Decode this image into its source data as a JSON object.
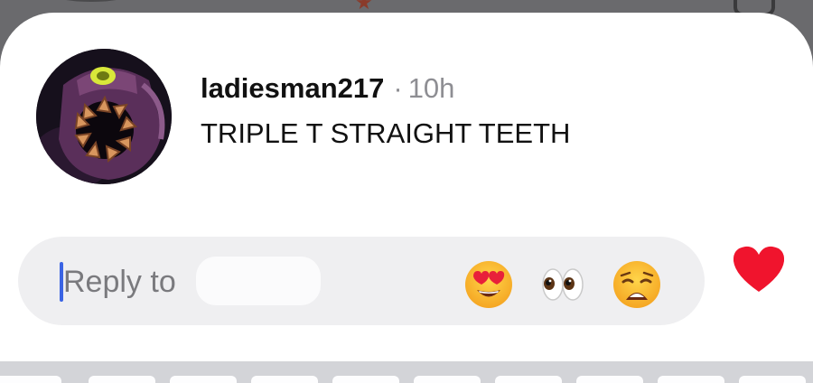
{
  "comment": {
    "username": "ladiesman217",
    "separator": "·",
    "time": "10h",
    "text": "TRIPLE T STRAIGHT TEETH"
  },
  "avatar": {
    "icon": "monster-avatar-icon",
    "colors": {
      "background": "#16101c",
      "shell": "#5a2f5a",
      "teeth": "#d8965e",
      "glow": "#d9e83a"
    }
  },
  "reply": {
    "placeholder": "Reply to",
    "recipient_redacted": true,
    "caret_color": "#3b64e4"
  },
  "quick_reactions": [
    {
      "icon": "heart-eyes-emoji",
      "label": "smiling face with heart-eyes"
    },
    {
      "icon": "eyes-emoji",
      "label": "eyes"
    },
    {
      "icon": "weary-face-emoji",
      "label": "weary face"
    }
  ],
  "like": {
    "icon": "heart-icon",
    "color": "#f0142d"
  }
}
